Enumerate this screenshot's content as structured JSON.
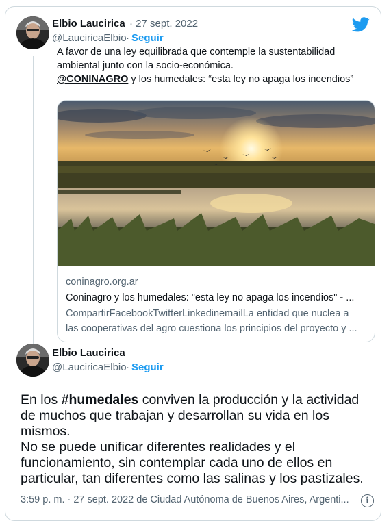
{
  "brand": {
    "icon": "twitter-bird-icon",
    "color": "#1d9bf0"
  },
  "tweet1": {
    "author_name": "Elbio Laucirica",
    "date": "· 27 sept. 2022",
    "handle": "@LauciricaElbio",
    "separator": "·",
    "follow_label": "Seguir",
    "text_line1": "A favor de una ley equilibrada que contemple la sustentabilidad",
    "text_line2": "ambiental junto con la socio-económica.",
    "mention": "@CONINAGRO",
    "text_line3_rest": " y los humedales: “esta ley no apaga los incendios”",
    "card": {
      "domain": "coninagro.org.ar",
      "title": "Coninagro y los humedales: \"esta ley no apaga los incendios\" - ...",
      "desc_line1": "CompartirFacebookTwitterLinkedinemailLa entidad que nuclea a",
      "desc_line2": "las cooperativas del agro cuestiona los principios del proyecto y ..."
    }
  },
  "tweet2": {
    "author_name": "Elbio Laucirica",
    "handle": "@LauciricaElbio",
    "separator": "·",
    "follow_label": "Seguir",
    "line1_pre": "En los ",
    "hashtag": "#humedales",
    "line1_post": " conviven la producción y la actividad",
    "line2": "de muchos que trabajan y desarrollan su vida en los",
    "line3": "mismos.",
    "line4": "No se puede unificar diferentes realidades y el",
    "line5": "funcionamiento, sin contemplar cada uno de ellos en",
    "line6": "particular, tan diferentes como las salinas y los pastizales.",
    "footer": "3:59 p. m. · 27 sept. 2022 de Ciudad Autónoma de Buenos Aires, Argenti...",
    "info_icon": "info-icon"
  }
}
